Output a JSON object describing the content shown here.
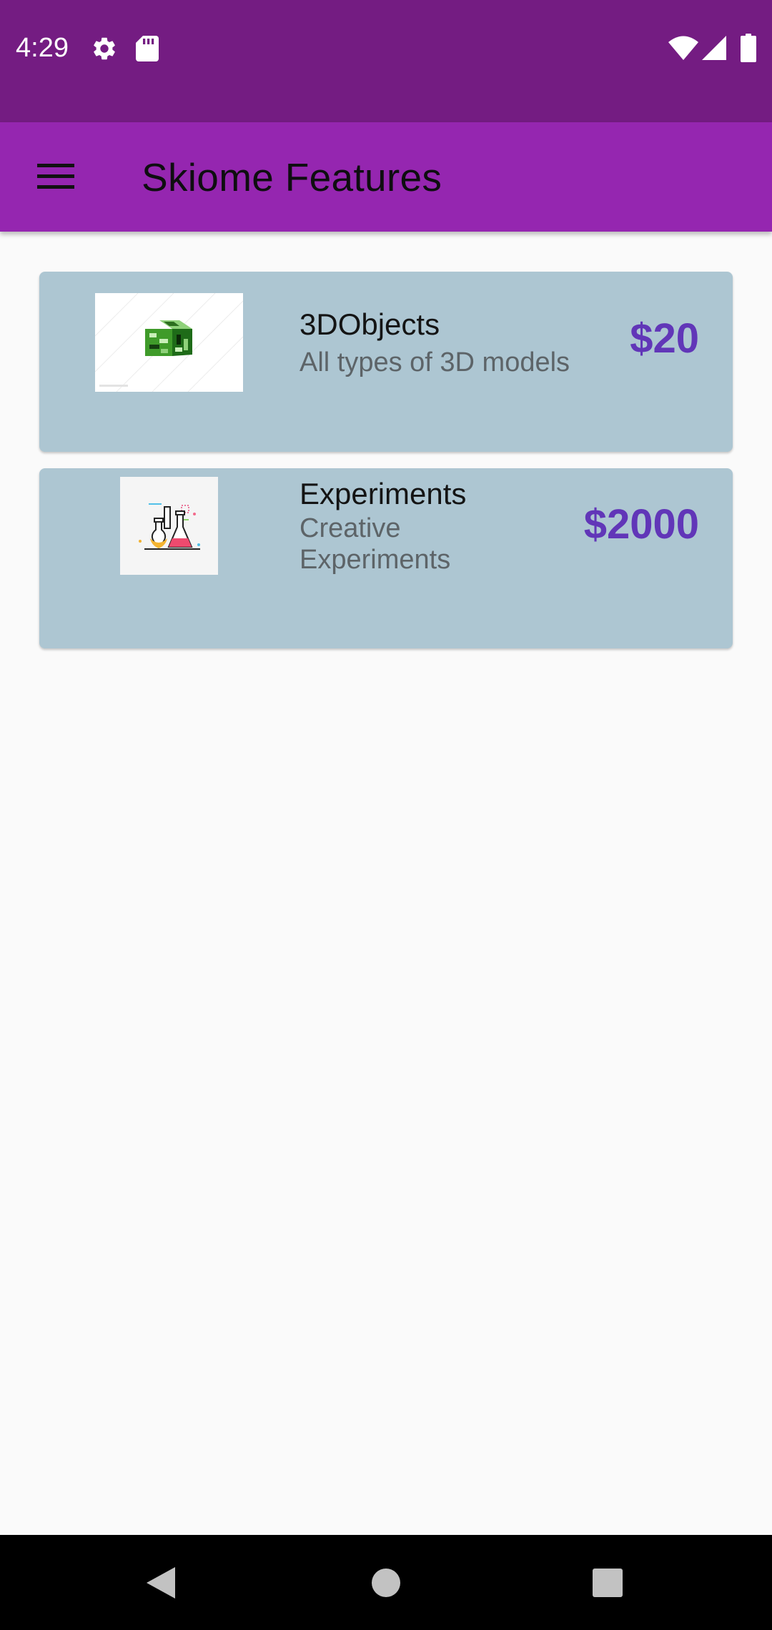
{
  "status_bar": {
    "time": "4:29",
    "icons_left": [
      "gear-icon",
      "sd-card-icon"
    ],
    "icons_right": [
      "wifi-icon",
      "cellular-signal-icon",
      "battery-icon"
    ]
  },
  "app_bar": {
    "title": "Skiome Features",
    "menu_icon": "hamburger-menu-icon"
  },
  "features": [
    {
      "title": "3DObjects",
      "subtitle": "All types of 3D models",
      "price": "$20",
      "image": "green-3d-cube-logo"
    },
    {
      "title": "Experiments",
      "subtitle": "Creative Experiments",
      "price": "$2000",
      "image": "chemistry-flasks-illustration"
    }
  ],
  "nav_bar": {
    "icons": [
      "back-icon",
      "home-icon",
      "recents-icon"
    ]
  },
  "colors": {
    "status_bar": "#741c82",
    "app_bar": "#9526b0",
    "card": "#adc6d2",
    "price": "#6136b8",
    "background": "#fafafa",
    "nav_bar": "#000000"
  }
}
